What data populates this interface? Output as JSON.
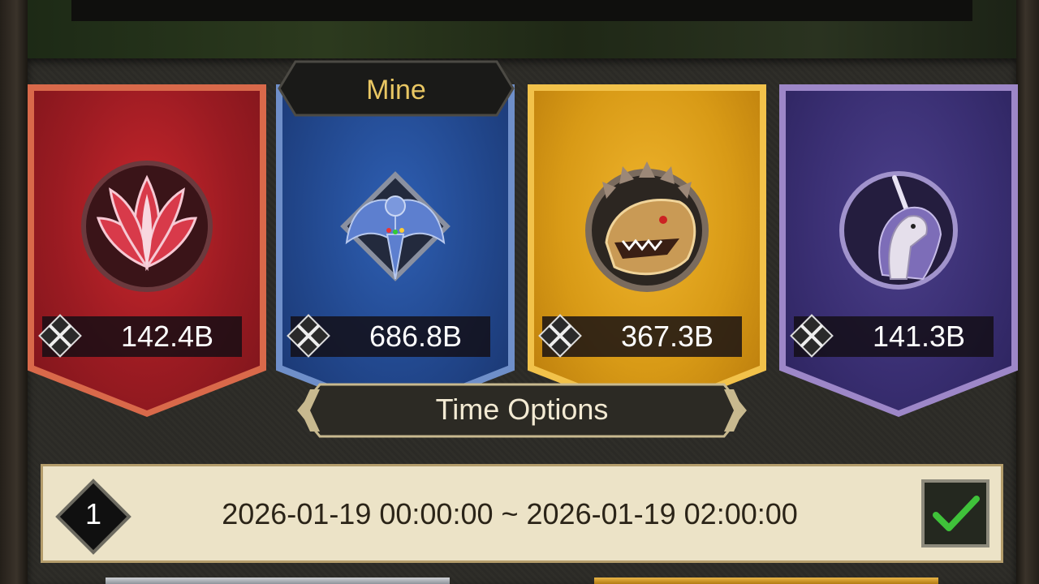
{
  "factions": [
    {
      "color": "red",
      "emblem": "lotus-emblem",
      "power": "142.4B"
    },
    {
      "color": "blue",
      "emblem": "phoenix-emblem",
      "power": "686.8B",
      "mine": true
    },
    {
      "color": "gold",
      "emblem": "dragon-emblem",
      "power": "367.3B"
    },
    {
      "color": "purple",
      "emblem": "unicorn-emblem",
      "power": "141.3B"
    }
  ],
  "mine_label": "Mine",
  "time_options_label": "Time Options",
  "time_slot": {
    "index": "1",
    "range": "2026-01-19 00:00:00 ~ 2026-01-19 02:00:00",
    "checked": true
  },
  "colors": {
    "accent_gold": "#e9c763",
    "check_green": "#3fc23a",
    "row_bg": "#ece3c7"
  }
}
